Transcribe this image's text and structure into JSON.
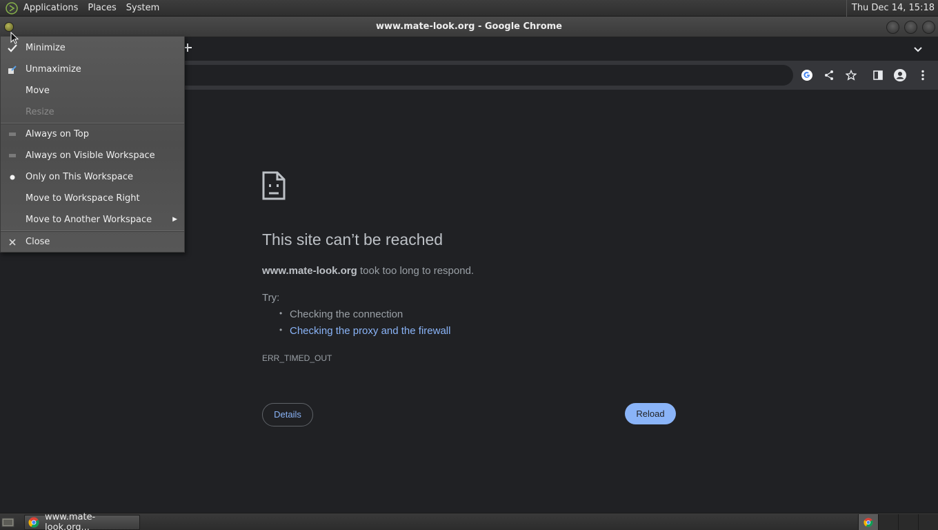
{
  "top_panel": {
    "menus": [
      "Applications",
      "Places",
      "System"
    ],
    "clock": "Thu Dec 14, 15:18"
  },
  "window": {
    "title": "www.mate-look.org - Google Chrome"
  },
  "window_menu": {
    "items": [
      {
        "label": "Minimize",
        "icon": "minimize-check-icon",
        "enabled": true
      },
      {
        "label": "Unmaximize",
        "icon": "unmaximize-icon",
        "enabled": true
      },
      {
        "label": "Move",
        "icon": "",
        "enabled": true
      },
      {
        "label": "Resize",
        "icon": "",
        "enabled": false
      },
      {
        "label": "Always on Top",
        "icon": "checkbox-icon",
        "enabled": true
      },
      {
        "label": "Always on Visible Workspace",
        "icon": "checkbox-icon",
        "enabled": true
      },
      {
        "label": "Only on This Workspace",
        "icon": "radio-selected-icon",
        "enabled": true
      },
      {
        "label": "Move to Workspace Right",
        "icon": "",
        "enabled": true
      },
      {
        "label": "Move to Another Workspace",
        "icon": "submenu-arrow-icon",
        "enabled": true
      },
      {
        "label": "Close",
        "icon": "close-icon",
        "enabled": true
      }
    ]
  },
  "error_page": {
    "title": "This site can’t be reached",
    "host": "www.mate-look.org",
    "message": " took too long to respond.",
    "try_label": "Try:",
    "suggestions": [
      "Checking the connection",
      "Checking the proxy and the firewall"
    ],
    "error_code": "ERR_TIMED_OUT",
    "details_label": "Details",
    "reload_label": "Reload"
  },
  "taskbar": {
    "task_label": "www.mate-look.org..."
  },
  "colors": {
    "page_bg": "#202124",
    "link": "#8ab4f8",
    "reload_bg": "#8ab4f8"
  }
}
